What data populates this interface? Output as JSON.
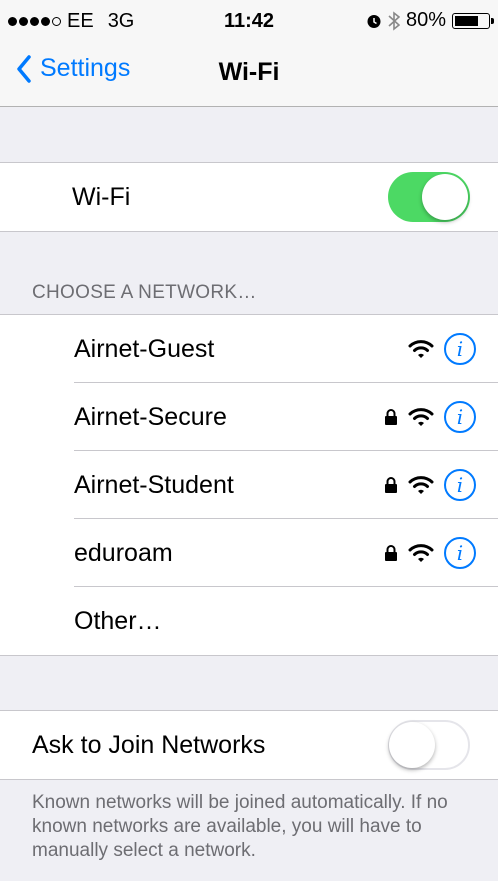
{
  "status": {
    "carrier": "EE",
    "network": "3G",
    "time": "11:42",
    "battery": "80%",
    "battery_level": 0.8
  },
  "nav": {
    "back_label": "Settings",
    "title": "Wi-Fi"
  },
  "wifi": {
    "label": "Wi-Fi",
    "enabled": true
  },
  "section_header": "CHOOSE A NETWORK…",
  "networks": [
    {
      "name": "Airnet-Guest",
      "secured": false
    },
    {
      "name": "Airnet-Secure",
      "secured": true
    },
    {
      "name": "Airnet-Student",
      "secured": true
    },
    {
      "name": "eduroam",
      "secured": true
    }
  ],
  "other_label": "Other…",
  "ask_join": {
    "label": "Ask to Join Networks",
    "enabled": false
  },
  "footer": "Known networks will be joined automatically. If no known networks are available, you will have to manually select a network.",
  "colors": {
    "accent": "#007aff",
    "switch_on": "#4cd964"
  },
  "icons": {
    "info": "i"
  }
}
